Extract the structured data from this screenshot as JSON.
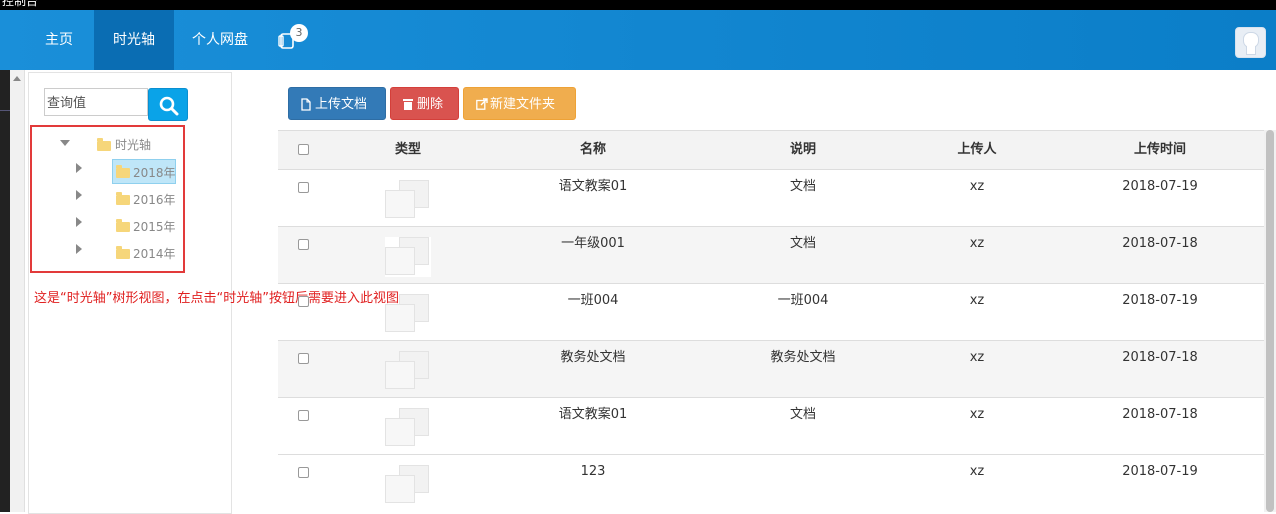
{
  "window": {
    "title": "控制台"
  },
  "nav": {
    "items": [
      {
        "label": "主页"
      },
      {
        "label": "时光轴"
      },
      {
        "label": "个人网盘"
      }
    ],
    "notification_count": "3",
    "icons": [
      "tablet-icon",
      "avatar"
    ]
  },
  "sidebar": {
    "search_placeholder": "查询值",
    "tree": {
      "root": "时光轴",
      "children": [
        "2018年",
        "2016年",
        "2015年",
        "2014年"
      ],
      "selected": "2018年"
    },
    "annotation": "这是“时光轴”树形视图，在点击“时光轴”按钮后需要进入此视图"
  },
  "toolbar": {
    "upload_label": "上传文档",
    "delete_label": "删除",
    "new_folder_label": "新建文件夹"
  },
  "table": {
    "headers": {
      "type": "类型",
      "name": "名称",
      "desc": "说明",
      "uploader": "上传人",
      "time": "上传时间"
    },
    "rows": [
      {
        "name": "语文教案01",
        "desc": "文档",
        "uploader": "xz",
        "time": "2018-07-19"
      },
      {
        "name": "一年级001",
        "desc": "文档",
        "uploader": "xz",
        "time": "2018-07-18"
      },
      {
        "name": "一班004",
        "desc": "一班004",
        "uploader": "xz",
        "time": "2018-07-19"
      },
      {
        "name": "教务处文档",
        "desc": "教务处文档",
        "uploader": "xz",
        "time": "2018-07-18"
      },
      {
        "name": "语文教案01",
        "desc": "文档",
        "uploader": "xz",
        "time": "2018-07-18"
      },
      {
        "name": "123",
        "desc": "",
        "uploader": "xz",
        "time": "2018-07-19"
      }
    ]
  },
  "colors": {
    "nav_bg": "#1a8fd9",
    "nav_active": "#0a6db3",
    "upload": "#337ab7",
    "delete": "#d9534f",
    "new_folder": "#f0ad4e",
    "annotation": "#e02020"
  }
}
